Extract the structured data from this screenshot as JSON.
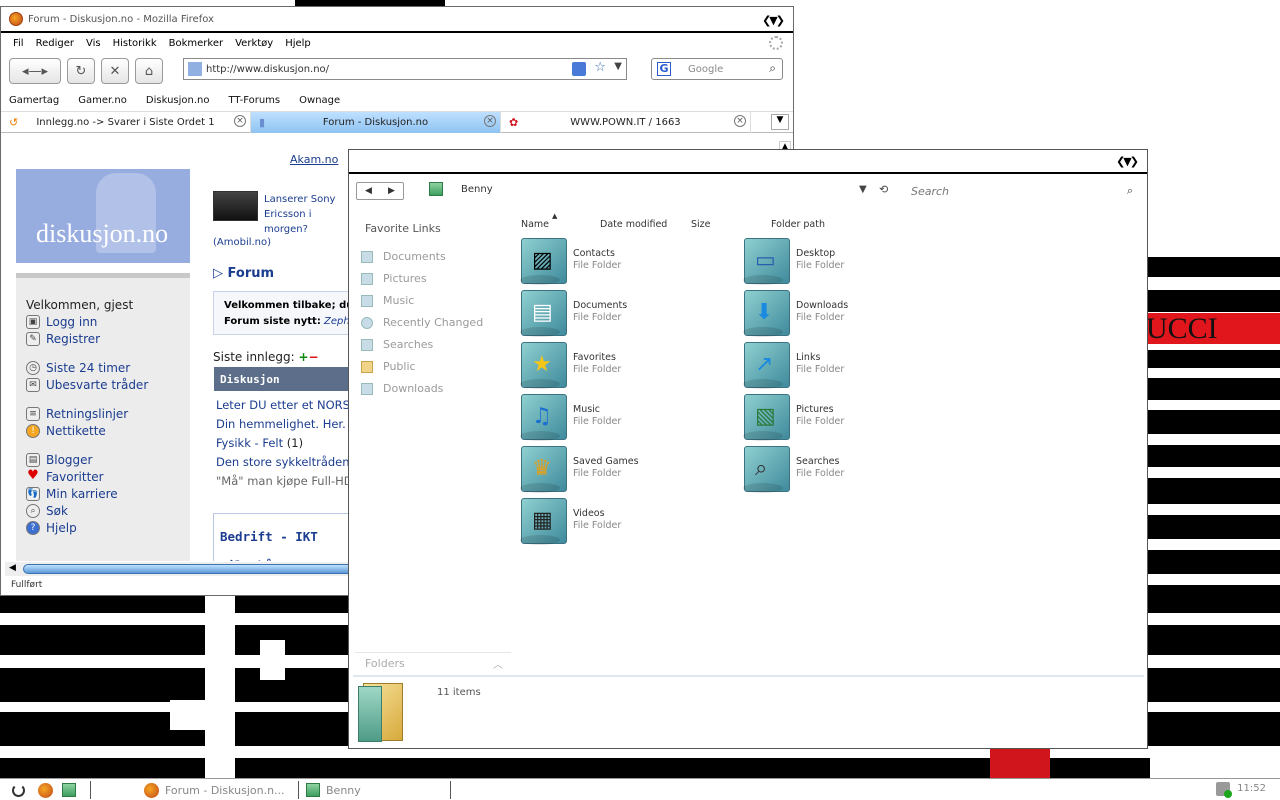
{
  "firefox": {
    "title": "Forum - Diskusjon.no - Mozilla Firefox",
    "menu": [
      "Fil",
      "Rediger",
      "Vis",
      "Historikk",
      "Bokmerker",
      "Verktøy",
      "Hjelp"
    ],
    "url": "http://www.diskusjon.no/",
    "search_placeholder": "Google",
    "bookmarks": [
      "Gamertag",
      "Gamer.no",
      "Diskusjon.no",
      "TT-Forums",
      "Ownage"
    ],
    "tabs": [
      {
        "label": "Innlegg.no -> Svarer i Siste Ordet 1"
      },
      {
        "label": "Forum - Diskusjon.no"
      },
      {
        "label": "WWW.POWN.IT / 1663"
      }
    ],
    "status": "Fullført",
    "page": {
      "akam": "Akam.no",
      "logo": "diskusjon.no",
      "news_text": "Lanserer Sony Ericsson i morgen?",
      "news_source": "(Amobil.no)",
      "forum_heading": "Forum",
      "welcome_line1": "Velkommen tilbake; du",
      "welcome_line2": "Forum siste nytt:",
      "welcome_zeph": "Zeph",
      "siste_label": "Siste innlegg:",
      "section_header": "Diskusjon",
      "posts": [
        "Leter DU etter et NORS",
        "Din hemmelighet. Her.",
        "Fysikk - Felt",
        "Den store sykkeltråden",
        "\"Må\" man kjøpe Full-HD"
      ],
      "fysikk_count": "(1)",
      "sub_sections": [
        "Bedrift - IKT",
        "Bil, båt og motor"
      ],
      "sidebar": {
        "greeting": "Velkommen, gjest",
        "login": "Logg inn",
        "register": "Registrer",
        "last24": "Siste 24 timer",
        "unanswered": "Ubesvarte tråder",
        "guidelines": "Retningslinjer",
        "netiquette": "Nettikette",
        "blogs": "Blogger",
        "favorites": "Favoritter",
        "career": "Min karriere",
        "search": "Søk",
        "help": "Hjelp"
      }
    }
  },
  "explorer": {
    "breadcrumb": "Benny",
    "search_placeholder": "Search",
    "favorite_links_title": "Favorite Links",
    "favorite_links": [
      "Documents",
      "Pictures",
      "Music",
      "Recently Changed",
      "Searches",
      "Public",
      "Downloads"
    ],
    "columns": [
      "Name",
      "Date modified",
      "Size",
      "Folder path"
    ],
    "items": [
      {
        "name": "Contacts",
        "type": "File Folder",
        "icon": "contacts-icon"
      },
      {
        "name": "Desktop",
        "type": "File Folder",
        "icon": "desktop-icon"
      },
      {
        "name": "Documents",
        "type": "File Folder",
        "icon": "documents-icon"
      },
      {
        "name": "Downloads",
        "type": "File Folder",
        "icon": "downloads-icon"
      },
      {
        "name": "Favorites",
        "type": "File Folder",
        "icon": "star-icon"
      },
      {
        "name": "Links",
        "type": "File Folder",
        "icon": "links-icon"
      },
      {
        "name": "Music",
        "type": "File Folder",
        "icon": "music-icon"
      },
      {
        "name": "Pictures",
        "type": "File Folder",
        "icon": "pictures-icon"
      },
      {
        "name": "Saved Games",
        "type": "File Folder",
        "icon": "saved-games-icon"
      },
      {
        "name": "Searches",
        "type": "File Folder",
        "icon": "searches-icon"
      },
      {
        "name": "Videos",
        "type": "File Folder",
        "icon": "videos-icon"
      }
    ],
    "folders_label": "Folders",
    "item_count": "11 items"
  },
  "taskbar": {
    "firefox_task": "Forum - Diskusjon.n...",
    "explorer_task": "Benny",
    "clock": "11:52"
  },
  "desktop": {
    "wallpaper_text": "UCCI"
  },
  "colors": {
    "diskusjon_blue": "#97acdf",
    "link_blue": "#1b3d8f",
    "active_tab": "#8ec4f2",
    "wallpaper_red": "#e0161c"
  }
}
